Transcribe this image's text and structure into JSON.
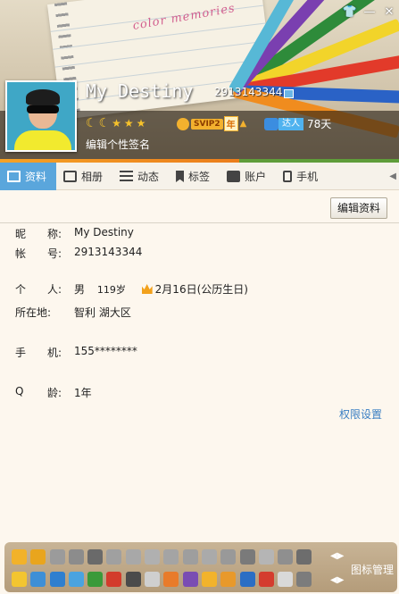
{
  "header": {
    "decoration_text": "color memories",
    "nickname": "My Destiny",
    "qq_number": "2913143344",
    "svip_label": "SVIP2",
    "year_label": "年",
    "daren_label": "达人",
    "daren_days": "78天",
    "signature_placeholder": "编辑个性签名",
    "window_buttons": [
      "skin-icon",
      "minimize-icon",
      "close-icon"
    ]
  },
  "tabs": [
    {
      "label": "资料",
      "icon": "profile-card-icon",
      "active": true
    },
    {
      "label": "相册",
      "icon": "photo-album-icon"
    },
    {
      "label": "动态",
      "icon": "feed-list-icon"
    },
    {
      "label": "标签",
      "icon": "bookmark-tag-icon"
    },
    {
      "label": "账户",
      "icon": "wallet-icon"
    },
    {
      "label": "手机",
      "icon": "mobile-phone-icon"
    }
  ],
  "profile": {
    "edit_button": "编辑资料",
    "nickname_label": [
      "昵",
      "称:"
    ],
    "nickname": "My Destiny",
    "account_label": [
      "帐",
      "号:"
    ],
    "account": "2913143344",
    "personal_label": [
      "个",
      "人:"
    ],
    "gender": "男",
    "age": "119岁",
    "birthday": "2月16日(公历生日)",
    "location_label": [
      "所在地:"
    ],
    "location": "智利 湖大区",
    "phone_label": [
      "手",
      "机:"
    ],
    "phone": "155********",
    "qage_label": [
      "Q",
      "龄:"
    ],
    "qage": "1年",
    "permission_link": "权限设置"
  },
  "icon_bar": {
    "manage_label": "图标管理",
    "colors": {
      "accent": "#5aa6dc",
      "link": "#3a7fc3",
      "gold": "#f6c22b"
    }
  }
}
